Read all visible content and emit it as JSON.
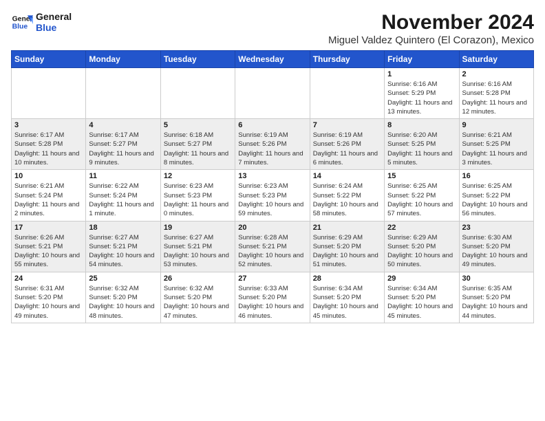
{
  "logo": {
    "line1": "General",
    "line2": "Blue"
  },
  "title": "November 2024",
  "subtitle": "Miguel Valdez Quintero (El Corazon), Mexico",
  "weekdays": [
    "Sunday",
    "Monday",
    "Tuesday",
    "Wednesday",
    "Thursday",
    "Friday",
    "Saturday"
  ],
  "weeks": [
    [
      {
        "day": "",
        "info": ""
      },
      {
        "day": "",
        "info": ""
      },
      {
        "day": "",
        "info": ""
      },
      {
        "day": "",
        "info": ""
      },
      {
        "day": "",
        "info": ""
      },
      {
        "day": "1",
        "info": "Sunrise: 6:16 AM\nSunset: 5:29 PM\nDaylight: 11 hours and 13 minutes."
      },
      {
        "day": "2",
        "info": "Sunrise: 6:16 AM\nSunset: 5:28 PM\nDaylight: 11 hours and 12 minutes."
      }
    ],
    [
      {
        "day": "3",
        "info": "Sunrise: 6:17 AM\nSunset: 5:28 PM\nDaylight: 11 hours and 10 minutes."
      },
      {
        "day": "4",
        "info": "Sunrise: 6:17 AM\nSunset: 5:27 PM\nDaylight: 11 hours and 9 minutes."
      },
      {
        "day": "5",
        "info": "Sunrise: 6:18 AM\nSunset: 5:27 PM\nDaylight: 11 hours and 8 minutes."
      },
      {
        "day": "6",
        "info": "Sunrise: 6:19 AM\nSunset: 5:26 PM\nDaylight: 11 hours and 7 minutes."
      },
      {
        "day": "7",
        "info": "Sunrise: 6:19 AM\nSunset: 5:26 PM\nDaylight: 11 hours and 6 minutes."
      },
      {
        "day": "8",
        "info": "Sunrise: 6:20 AM\nSunset: 5:25 PM\nDaylight: 11 hours and 5 minutes."
      },
      {
        "day": "9",
        "info": "Sunrise: 6:21 AM\nSunset: 5:25 PM\nDaylight: 11 hours and 3 minutes."
      }
    ],
    [
      {
        "day": "10",
        "info": "Sunrise: 6:21 AM\nSunset: 5:24 PM\nDaylight: 11 hours and 2 minutes."
      },
      {
        "day": "11",
        "info": "Sunrise: 6:22 AM\nSunset: 5:24 PM\nDaylight: 11 hours and 1 minute."
      },
      {
        "day": "12",
        "info": "Sunrise: 6:23 AM\nSunset: 5:23 PM\nDaylight: 11 hours and 0 minutes."
      },
      {
        "day": "13",
        "info": "Sunrise: 6:23 AM\nSunset: 5:23 PM\nDaylight: 10 hours and 59 minutes."
      },
      {
        "day": "14",
        "info": "Sunrise: 6:24 AM\nSunset: 5:22 PM\nDaylight: 10 hours and 58 minutes."
      },
      {
        "day": "15",
        "info": "Sunrise: 6:25 AM\nSunset: 5:22 PM\nDaylight: 10 hours and 57 minutes."
      },
      {
        "day": "16",
        "info": "Sunrise: 6:25 AM\nSunset: 5:22 PM\nDaylight: 10 hours and 56 minutes."
      }
    ],
    [
      {
        "day": "17",
        "info": "Sunrise: 6:26 AM\nSunset: 5:21 PM\nDaylight: 10 hours and 55 minutes."
      },
      {
        "day": "18",
        "info": "Sunrise: 6:27 AM\nSunset: 5:21 PM\nDaylight: 10 hours and 54 minutes."
      },
      {
        "day": "19",
        "info": "Sunrise: 6:27 AM\nSunset: 5:21 PM\nDaylight: 10 hours and 53 minutes."
      },
      {
        "day": "20",
        "info": "Sunrise: 6:28 AM\nSunset: 5:21 PM\nDaylight: 10 hours and 52 minutes."
      },
      {
        "day": "21",
        "info": "Sunrise: 6:29 AM\nSunset: 5:20 PM\nDaylight: 10 hours and 51 minutes."
      },
      {
        "day": "22",
        "info": "Sunrise: 6:29 AM\nSunset: 5:20 PM\nDaylight: 10 hours and 50 minutes."
      },
      {
        "day": "23",
        "info": "Sunrise: 6:30 AM\nSunset: 5:20 PM\nDaylight: 10 hours and 49 minutes."
      }
    ],
    [
      {
        "day": "24",
        "info": "Sunrise: 6:31 AM\nSunset: 5:20 PM\nDaylight: 10 hours and 49 minutes."
      },
      {
        "day": "25",
        "info": "Sunrise: 6:32 AM\nSunset: 5:20 PM\nDaylight: 10 hours and 48 minutes."
      },
      {
        "day": "26",
        "info": "Sunrise: 6:32 AM\nSunset: 5:20 PM\nDaylight: 10 hours and 47 minutes."
      },
      {
        "day": "27",
        "info": "Sunrise: 6:33 AM\nSunset: 5:20 PM\nDaylight: 10 hours and 46 minutes."
      },
      {
        "day": "28",
        "info": "Sunrise: 6:34 AM\nSunset: 5:20 PM\nDaylight: 10 hours and 45 minutes."
      },
      {
        "day": "29",
        "info": "Sunrise: 6:34 AM\nSunset: 5:20 PM\nDaylight: 10 hours and 45 minutes."
      },
      {
        "day": "30",
        "info": "Sunrise: 6:35 AM\nSunset: 5:20 PM\nDaylight: 10 hours and 44 minutes."
      }
    ]
  ]
}
